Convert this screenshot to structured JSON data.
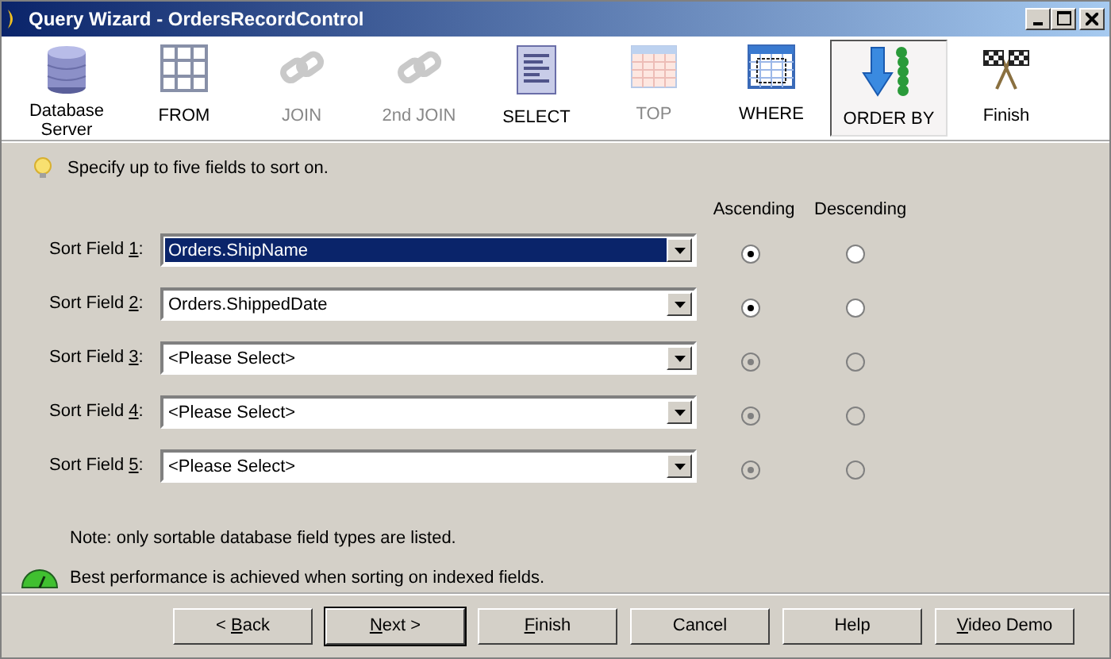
{
  "window": {
    "title": "Query Wizard - OrdersRecordControl"
  },
  "steps": [
    {
      "label": "Database Server",
      "selected": false,
      "disabled": false
    },
    {
      "label": "FROM",
      "selected": false,
      "disabled": false
    },
    {
      "label": "JOIN",
      "selected": false,
      "disabled": true
    },
    {
      "label": "2nd JOIN",
      "selected": false,
      "disabled": true
    },
    {
      "label": "SELECT",
      "selected": false,
      "disabled": false
    },
    {
      "label": "TOP",
      "selected": false,
      "disabled": true
    },
    {
      "label": "WHERE",
      "selected": false,
      "disabled": false
    },
    {
      "label": "ORDER BY",
      "selected": true,
      "disabled": false
    },
    {
      "label": "Finish",
      "selected": false,
      "disabled": false
    }
  ],
  "hint": "Specify up to five fields to sort on.",
  "columns": [
    "Ascending",
    "Descending"
  ],
  "sort_fields": [
    {
      "label": "Sort Field ",
      "access_key": "1",
      "label_end": ":",
      "value": "Orders.ShipName",
      "focused": true,
      "ascending": true,
      "disabled": false
    },
    {
      "label": "Sort Field ",
      "access_key": "2",
      "label_end": ":",
      "value": "Orders.ShippedDate",
      "focused": false,
      "ascending": true,
      "disabled": false
    },
    {
      "label": "Sort Field ",
      "access_key": "3",
      "label_end": ":",
      "value": "<Please Select>",
      "focused": false,
      "ascending": true,
      "disabled": true
    },
    {
      "label": "Sort Field ",
      "access_key": "4",
      "label_end": ":",
      "value": "<Please Select>",
      "focused": false,
      "ascending": true,
      "disabled": true
    },
    {
      "label": "Sort Field ",
      "access_key": "5",
      "label_end": ":",
      "value": "<Please Select>",
      "focused": false,
      "ascending": true,
      "disabled": true
    }
  ],
  "note": "Note: only sortable database field types are listed.",
  "performance_tip": "Best performance is achieved when sorting on indexed fields.",
  "buttons": [
    {
      "before": "< ",
      "access_key": "B",
      "after": "ack",
      "default": false
    },
    {
      "access_key": "N",
      "after": "ext >",
      "default": true
    },
    {
      "access_key": "F",
      "after": "inish",
      "default": false
    },
    {
      "after": "Cancel",
      "default": false
    },
    {
      "after": "Help",
      "default": false
    },
    {
      "access_key": "V",
      "after": "ideo Demo",
      "default": false
    }
  ]
}
